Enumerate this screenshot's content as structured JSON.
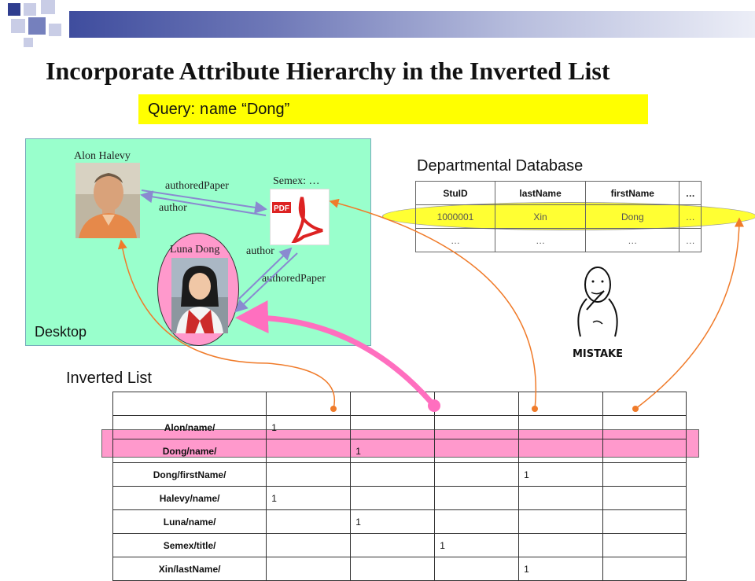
{
  "title": "Incorporate Attribute Hierarchy in the Inverted List",
  "query": {
    "prefix": "Query:",
    "field": "name",
    "value": "“Dong”"
  },
  "desktop": {
    "label": "Desktop",
    "person1": "Alon Halevy",
    "person2": "Luna Dong",
    "doc": "Semex: …",
    "edges": {
      "authored_paper_1": "authoredPaper",
      "author_1": "author",
      "author_2": "author",
      "authored_paper_2": "authoredPaper"
    }
  },
  "department": {
    "title": "Departmental Database",
    "headers": [
      "StuID",
      "lastName",
      "firstName",
      "…"
    ],
    "rows": [
      [
        "1000001",
        "Xin",
        "Dong",
        "…"
      ],
      [
        "…",
        "…",
        "…",
        "…"
      ]
    ]
  },
  "mistake_label": "MISTAKE",
  "inverted_list": {
    "title": "Inverted List",
    "rows": [
      {
        "term": "Alon/name/",
        "cells": [
          "1",
          "",
          "",
          "",
          ""
        ]
      },
      {
        "term": "Dong/name/",
        "cells": [
          "",
          "1",
          "",
          "",
          ""
        ]
      },
      {
        "term": "Dong/firstName/",
        "cells": [
          "",
          "",
          "",
          "1",
          ""
        ]
      },
      {
        "term": "Halevy/name/",
        "cells": [
          "1",
          "",
          "",
          "",
          ""
        ]
      },
      {
        "term": "Luna/name/",
        "cells": [
          "",
          "1",
          "",
          "",
          ""
        ]
      },
      {
        "term": "Semex/title/",
        "cells": [
          "",
          "",
          "1",
          "",
          ""
        ]
      },
      {
        "term": "Xin/lastName/",
        "cells": [
          "",
          "",
          "",
          "1",
          ""
        ]
      }
    ]
  },
  "colors": {
    "desktop_bg": "#99ffcc",
    "query_bg": "#ffff00",
    "highlight_pink": "#ff99cc",
    "arrow_orange": "#f07b2a"
  }
}
